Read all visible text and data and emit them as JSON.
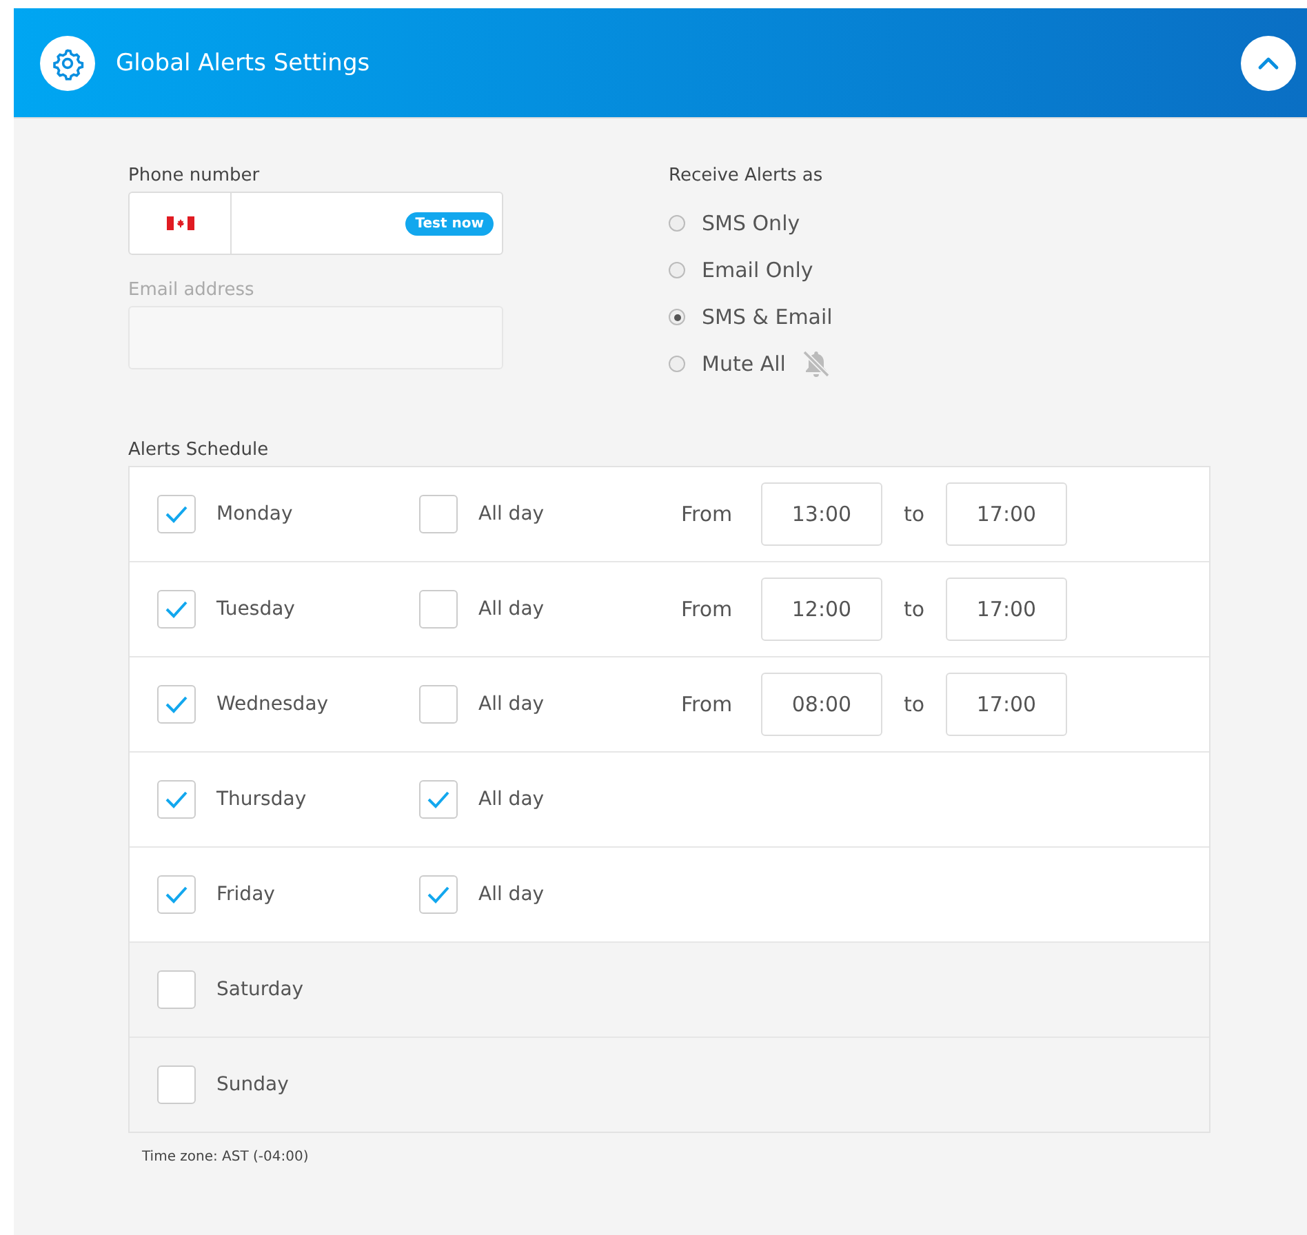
{
  "header": {
    "title": "Global Alerts Settings",
    "expanded": true
  },
  "phone": {
    "label": "Phone number",
    "test_button": "Test now"
  },
  "email": {
    "label": "Email address",
    "disabled": true
  },
  "receive": {
    "label": "Receive Alerts as",
    "options": [
      {
        "label": "SMS Only",
        "selected": false,
        "kind": "channel"
      },
      {
        "label": "Email Only",
        "selected": false,
        "kind": "channel"
      },
      {
        "label": "SMS & Email",
        "selected": true,
        "kind": "channel"
      },
      {
        "label": "Mute All",
        "selected": false,
        "kind": "mute"
      }
    ]
  },
  "schedule": {
    "label": "Alerts Schedule",
    "days": [
      {
        "name": "Monday",
        "checked": true,
        "all_day": {
          "label": "All day",
          "checked": false
        },
        "from_label": "From",
        "from": "13:00",
        "to_label": "to",
        "to": "17:00"
      },
      {
        "name": "Tuesday",
        "checked": true,
        "all_day": {
          "label": "All day",
          "checked": false
        },
        "from_label": "From",
        "from": "12:00",
        "to_label": "to",
        "to": "17:00"
      },
      {
        "name": "Wednesday",
        "checked": true,
        "all_day": {
          "label": "All day",
          "checked": false
        },
        "from_label": "From",
        "from": "08:00",
        "to_label": "to",
        "to": "17:00"
      },
      {
        "name": "Thursday",
        "checked": true,
        "all_day": {
          "label": "All day",
          "checked": true
        }
      },
      {
        "name": "Friday",
        "checked": true,
        "all_day": {
          "label": "All day",
          "checked": true
        }
      },
      {
        "name": "Saturday",
        "checked": false
      },
      {
        "name": "Sunday",
        "checked": false
      }
    ],
    "timezone": "Time zone: AST (-04:00)"
  }
}
